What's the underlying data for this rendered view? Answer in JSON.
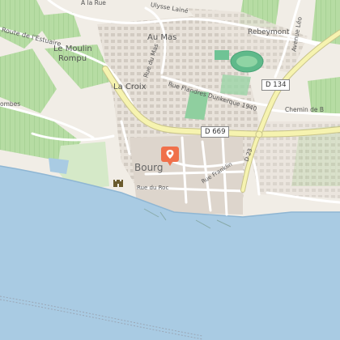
{
  "map": {
    "labels": {
      "bourg": "Bourg",
      "au_mas": "Au Mas",
      "moulin_line1": "Le Moulin",
      "moulin_line2": "Rompu",
      "la_croix": "La Croix",
      "rebeymont": "Rebeymont",
      "route_estuaire": "Route de l'Estuaire",
      "rue_du_mas": "Rue du Mas",
      "rue_flandres": "Rue Flandres Dunkerque 1940",
      "chemin_de": "Chemin de B",
      "avenue_leo": "Avenue Léo",
      "rue_du_roc": "Rue du Roc",
      "rue_franklin": "Rue Franklin",
      "la_rue": "À la Rue",
      "ulysse": "Ulysse Lainé",
      "ombes": "ombes",
      "d_23": "D 23"
    },
    "shields": {
      "d669": "D 669",
      "d134": "D 134"
    },
    "colors": {
      "land": "#f1ede6",
      "water": "#a9cbe3",
      "vineyard": "#acd49a",
      "road_major": "#f6f3b0",
      "road_minor": "#ffffff",
      "buildings": "#d3cdc5",
      "marker": "#f0704a",
      "pitch": "#8fcf9f",
      "track": "#60b98a"
    },
    "icons": {
      "marker": "map-pin-icon",
      "castle": "castle-icon"
    }
  }
}
